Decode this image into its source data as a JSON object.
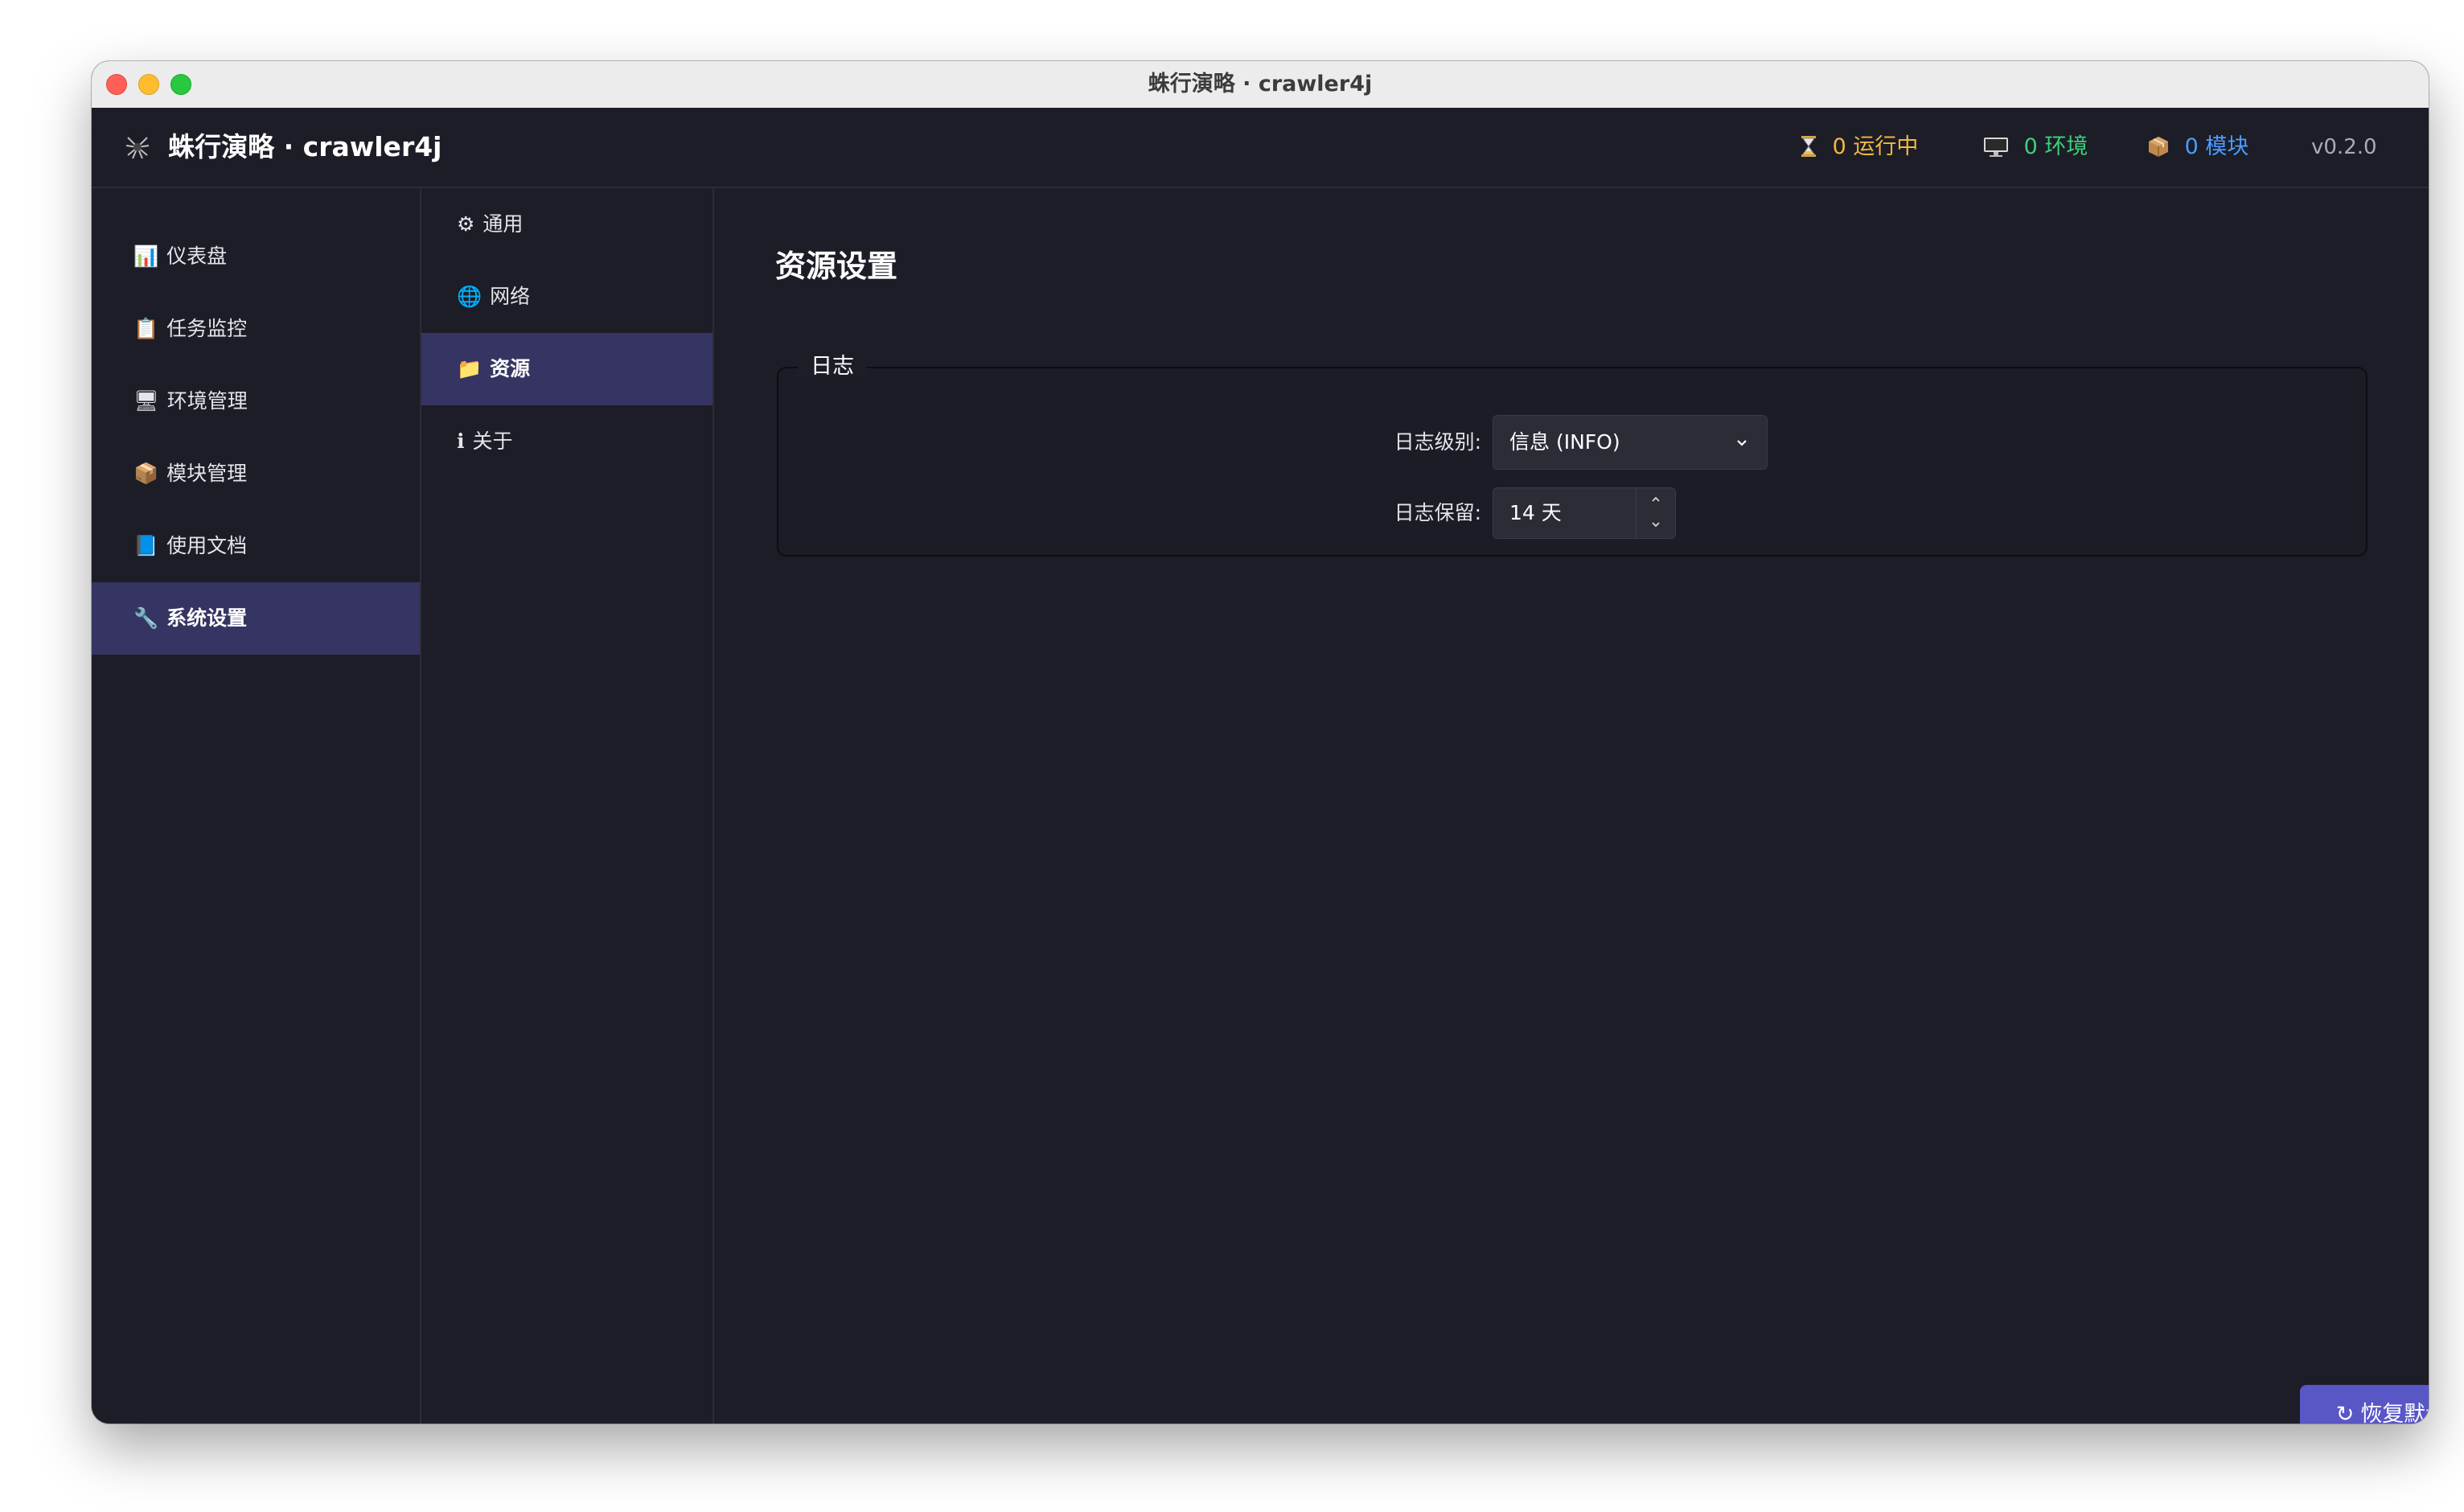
{
  "window": {
    "title": "蛛行演略 · crawler4j"
  },
  "header": {
    "brand_icon": "spider-icon",
    "brand": "蛛行演略 · crawler4j",
    "stats": {
      "running": {
        "icon": "hourglass-icon",
        "label": "0 运行中",
        "color": "#f3b93b"
      },
      "env": {
        "icon": "monitor-icon",
        "label": "0 环境",
        "color": "#3ed07a"
      },
      "module": {
        "icon": "package-icon",
        "label": "0 模块",
        "color": "#4b9cff"
      }
    },
    "version": "v0.2.0"
  },
  "sidebar": {
    "items": [
      {
        "icon": "📊",
        "label": "仪表盘"
      },
      {
        "icon": "📋",
        "label": "任务监控"
      },
      {
        "icon": "🖥",
        "label": "环境管理"
      },
      {
        "icon": "📦",
        "label": "模块管理"
      },
      {
        "icon": "📘",
        "label": "使用文档"
      },
      {
        "icon": "🔧",
        "label": "系统设置"
      }
    ],
    "active": "系统设置"
  },
  "subnav": {
    "items": [
      {
        "icon": "⚙",
        "label": "通用"
      },
      {
        "icon": "🌐",
        "label": "网络"
      },
      {
        "icon": "📁",
        "label": "资源"
      },
      {
        "icon": "ℹ",
        "label": "关于"
      }
    ],
    "active": "资源"
  },
  "main": {
    "title": "资源设置",
    "log_group": {
      "legend": "日志",
      "level_label": "日志级别:",
      "level_value": "信息 (INFO)",
      "retention_label": "日志保留:",
      "retention_value": "14 天"
    },
    "reset_icon": "↻",
    "reset_label": "恢复默认"
  },
  "colors": {
    "accent": "#5956c6",
    "active_bg": "#353463",
    "background": "#1c1d27"
  }
}
